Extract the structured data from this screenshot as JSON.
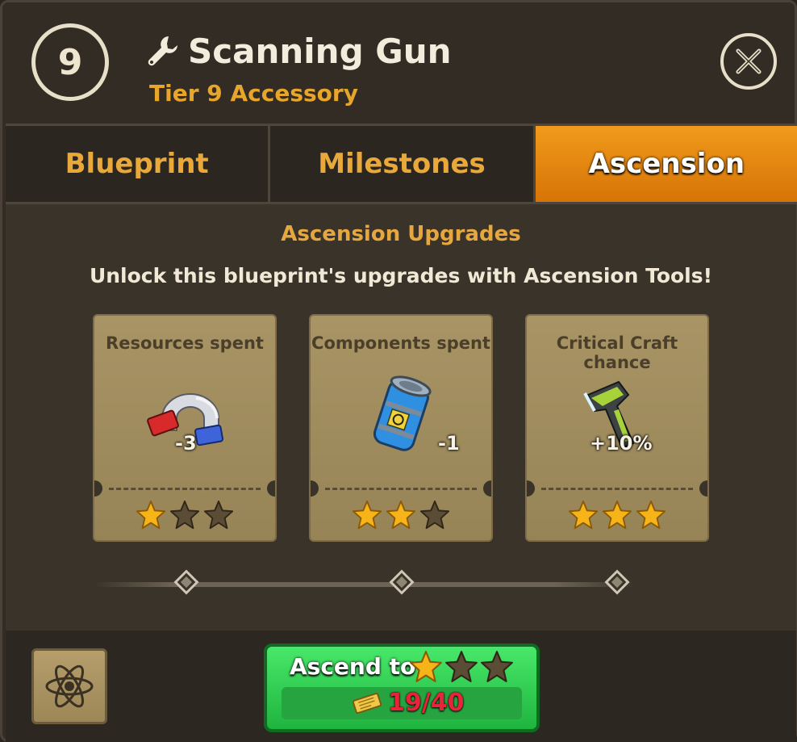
{
  "header": {
    "tier_number": "9",
    "item_name": "Scanning Gun",
    "item_subtitle": "Tier 9 Accessory",
    "wrench_icon": "wrench-icon",
    "close_icon": "close-icon"
  },
  "tabs": [
    {
      "label": "Blueprint",
      "active": false
    },
    {
      "label": "Milestones",
      "active": false
    },
    {
      "label": "Ascension",
      "active": true
    }
  ],
  "ascension": {
    "title": "Ascension Upgrades",
    "description": "Unlock this blueprint's upgrades with Ascension Tools!",
    "upgrades": [
      {
        "title": "Resources spent",
        "value": "-3",
        "icon": "magnet-icon",
        "stars_filled": 1,
        "stars_total": 3
      },
      {
        "title": "Components spent",
        "value": "-1",
        "icon": "canister-icon",
        "stars_filled": 2,
        "stars_total": 3
      },
      {
        "title": "Critical Craft chance",
        "value": "+10%",
        "icon": "scanner-icon",
        "stars_filled": 3,
        "stars_total": 3
      }
    ]
  },
  "footer": {
    "atom_icon": "atom-icon",
    "ascend_label": "Ascend to",
    "ascend_stars_filled": 1,
    "ascend_stars_total": 3,
    "cost_icon": "gold-ticket-icon",
    "cost_text": "19/40"
  },
  "colors": {
    "accent_orange": "#e9a93a",
    "active_tab": "#f19a1c",
    "ascend_green": "#2fcf52",
    "cost_red": "#e8243a",
    "star_gold": "#f6b418",
    "star_empty": "#5b4c35"
  }
}
